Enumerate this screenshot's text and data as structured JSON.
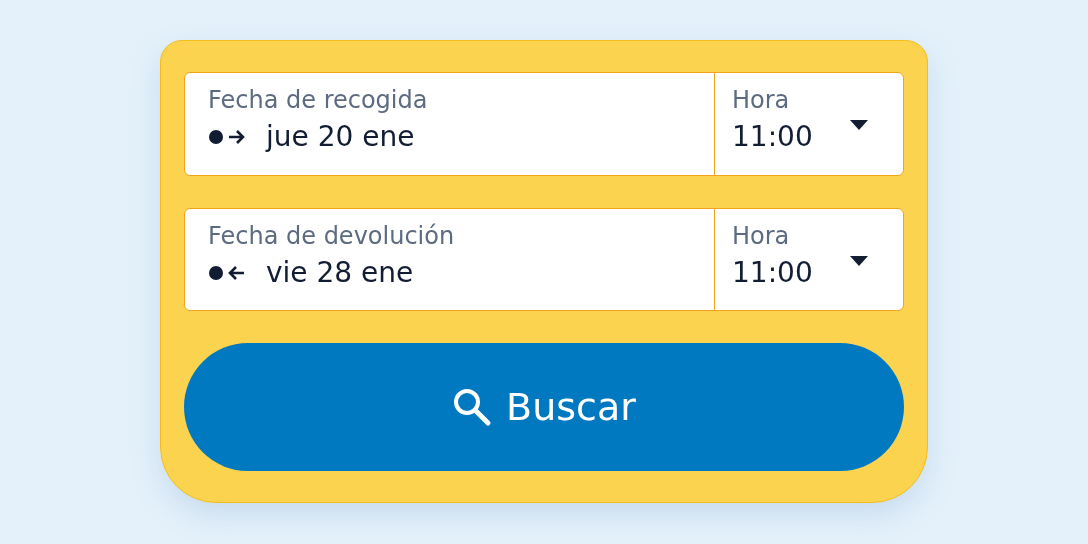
{
  "fields": [
    {
      "kind": "pickup",
      "date_label": "Fecha de recogida",
      "date_value": "jue 20 ene",
      "time_label": "Hora",
      "time_value": "11:00"
    },
    {
      "kind": "return",
      "date_label": "Fecha de devolución",
      "date_value": "vie 28 ene",
      "time_label": "Hora",
      "time_value": "11:00"
    }
  ],
  "search_button": {
    "label": "Buscar"
  }
}
